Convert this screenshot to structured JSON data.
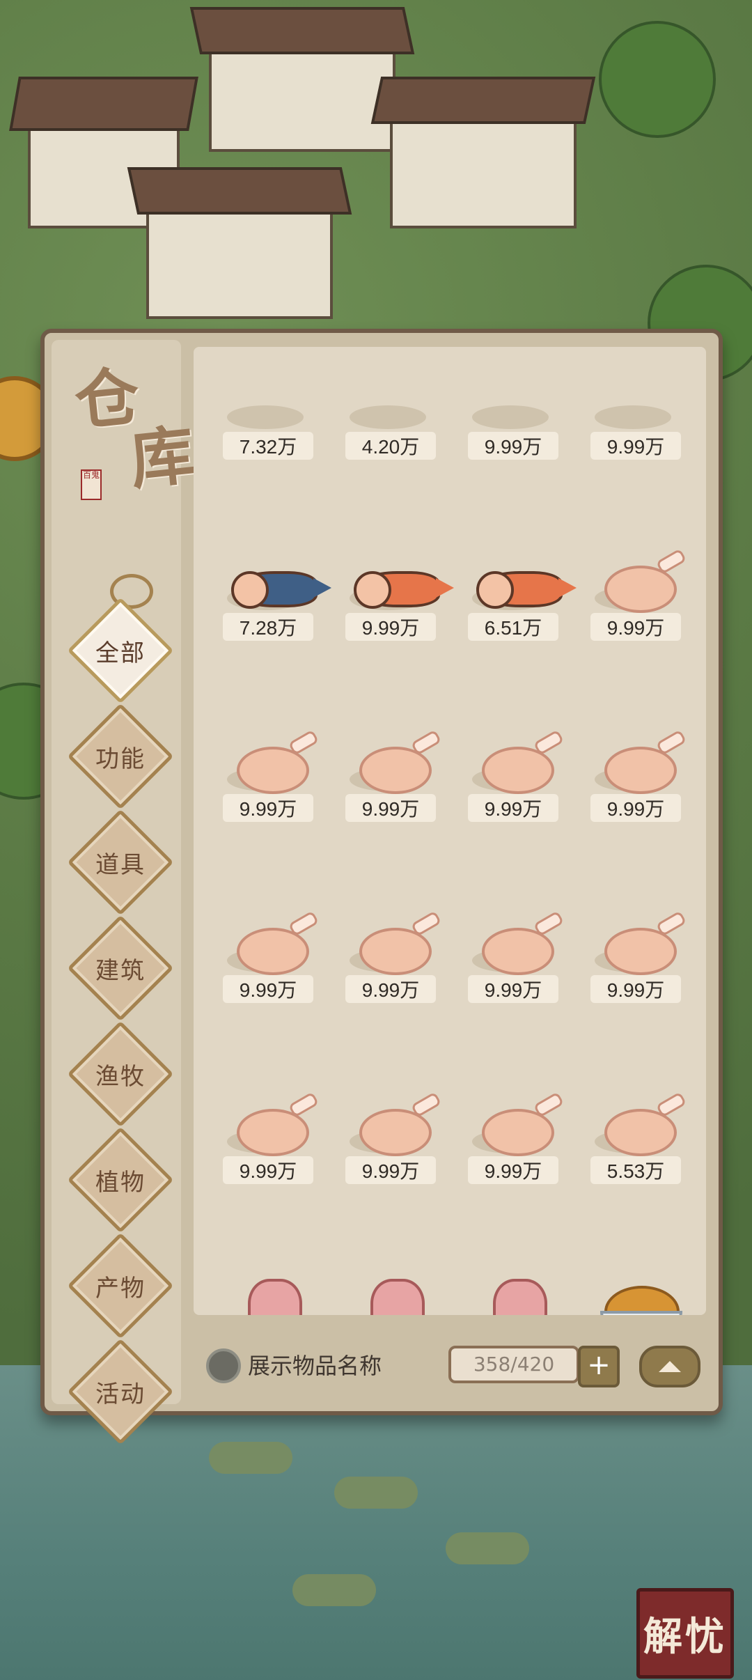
{
  "warehouse": {
    "title_line1": "仓",
    "title_line2": "库",
    "seal_text": "百鬼",
    "tabs": [
      {
        "label": "全部",
        "active": true
      },
      {
        "label": "功能",
        "active": false
      },
      {
        "label": "道具",
        "active": false
      },
      {
        "label": "建筑",
        "active": false
      },
      {
        "label": "渔牧",
        "active": false
      },
      {
        "label": "植物",
        "active": false
      },
      {
        "label": "产物",
        "active": false
      },
      {
        "label": "活动",
        "active": false
      }
    ],
    "items_counts": [
      "7.32万",
      "4.20万",
      "9.99万",
      "9.99万",
      "7.28万",
      "9.99万",
      "6.51万",
      "9.99万",
      "9.99万",
      "9.99万",
      "9.99万",
      "9.99万",
      "9.99万",
      "9.99万",
      "9.99万",
      "9.99万",
      "9.99万",
      "9.99万",
      "9.99万",
      "5.53万"
    ],
    "bottom": {
      "toggle_label": "展示物品名称",
      "capacity": "358/420",
      "plus": "+"
    }
  },
  "corner_stamp": "解忧"
}
